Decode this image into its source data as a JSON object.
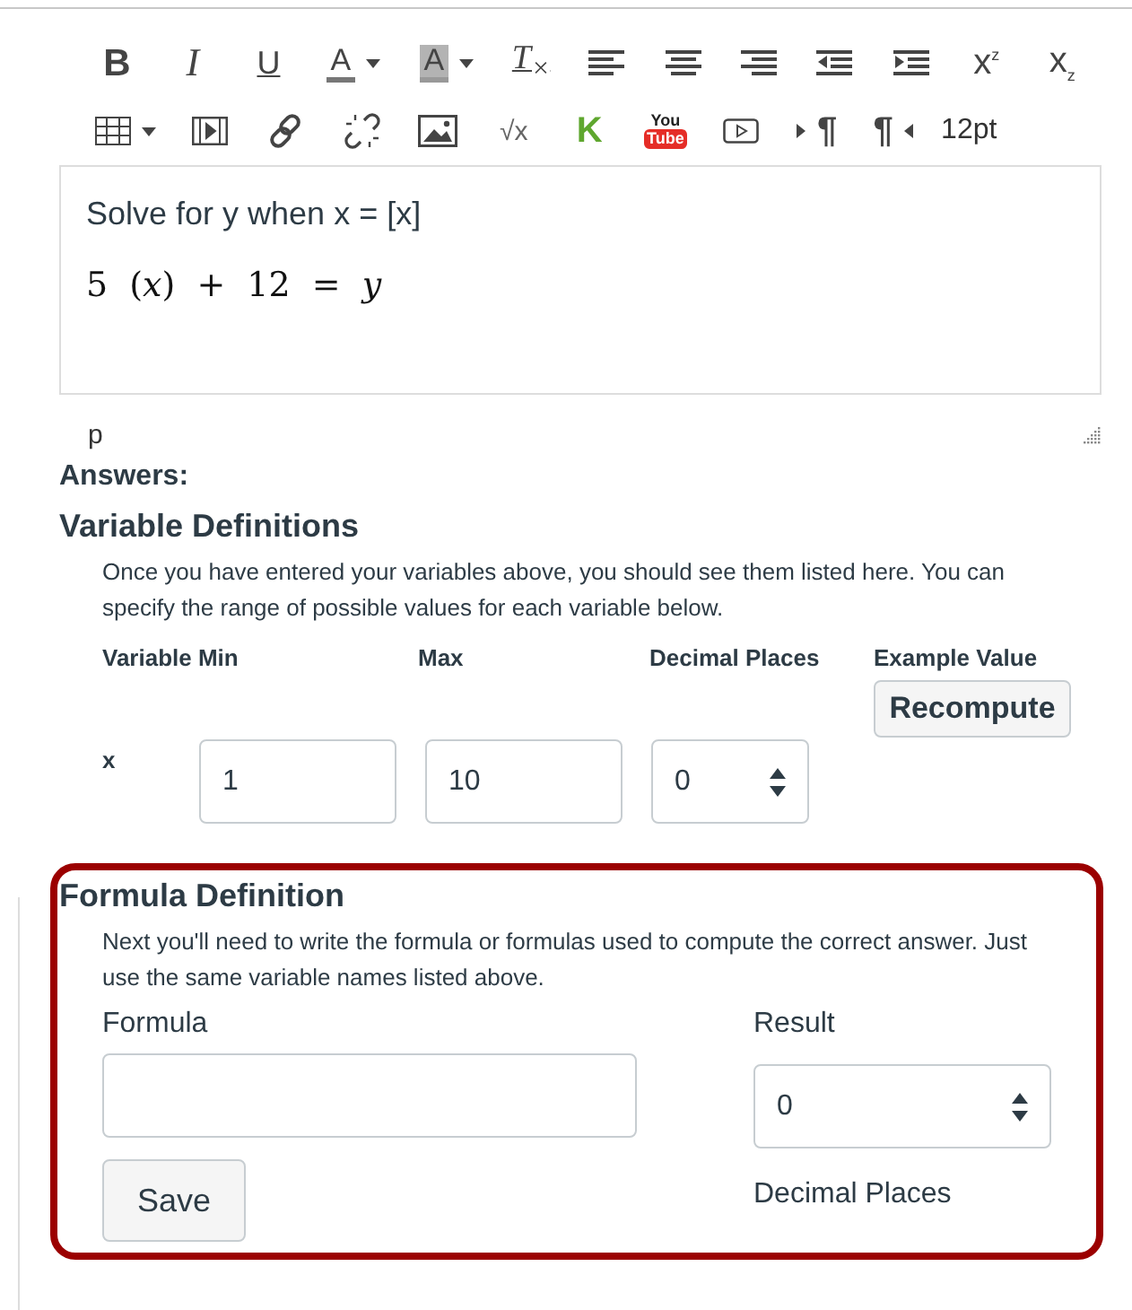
{
  "toolbar": {
    "rows": [
      [
        {
          "kind": "bold",
          "text": "B"
        },
        {
          "kind": "italic",
          "text": "I"
        },
        {
          "kind": "underline",
          "text": "U"
        },
        {
          "kind": "text-color",
          "text": "A"
        },
        {
          "kind": "highlight-color",
          "text": "A"
        },
        {
          "kind": "clear-format",
          "text": "T$_{×}$"
        },
        {
          "kind": "align-left"
        },
        {
          "kind": "align-center"
        },
        {
          "kind": "align-right"
        },
        {
          "kind": "outdent"
        },
        {
          "kind": "indent"
        },
        {
          "kind": "superscript",
          "text": "x$^{z}$"
        },
        {
          "kind": "subscript",
          "text": "x$_{z}$"
        }
      ],
      [
        {
          "kind": "table"
        },
        {
          "kind": "media"
        },
        {
          "kind": "link"
        },
        {
          "kind": "unlink"
        },
        {
          "kind": "image"
        },
        {
          "kind": "equation",
          "text": "√x"
        },
        {
          "kind": "k-logo",
          "text": "K"
        },
        {
          "kind": "youtube",
          "top": "You",
          "bottom": "Tube"
        },
        {
          "kind": "video"
        },
        {
          "kind": "ltr",
          "text": "¶"
        },
        {
          "kind": "rtl",
          "text": "¶"
        },
        {
          "kind": "font-size",
          "text": "12pt"
        }
      ]
    ]
  },
  "editor": {
    "prompt": "Solve for y when x = [x]",
    "equation": "5 (*x*) + 12 = *y*",
    "path": "p"
  },
  "answers_label": "Answers:",
  "variable_definitions": {
    "title": "Variable Definitions",
    "description": "Once you have entered your variables above, you should see them listed here. You can specify the range of possible values for each variable below.",
    "columns": [
      "Variable Min",
      "Max",
      "Decimal Places",
      "Example Value"
    ],
    "recompute_button": "Recompute",
    "rows": [
      {
        "variable": "x",
        "min": "1",
        "max": "10",
        "decimal_places": "0"
      }
    ]
  },
  "formula_definition": {
    "highlighted": true,
    "title": "Formula Definition",
    "description": "Next you'll need to write the formula or formulas used to compute the correct answer. Just use the same variable names listed above.",
    "formula_label": "Formula",
    "result_label": "Result",
    "result_value": "0",
    "decimal_places_label": "Decimal Places",
    "save_button": "Save"
  }
}
